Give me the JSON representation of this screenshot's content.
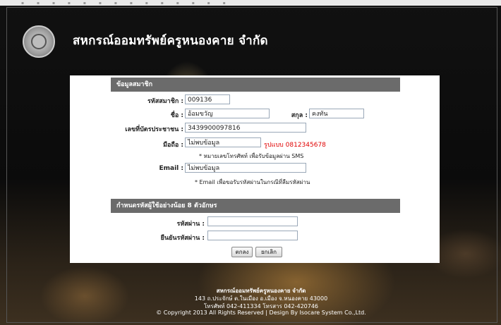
{
  "header": {
    "title": "สหกรณ์ออมทรัพย์ครูหนองคาย จำกัด"
  },
  "member_section": {
    "heading": "ข้อมูลสมาชิก",
    "member_id_label": "รหัสสมาชิก :",
    "member_id_value": "009136",
    "firstname_label": "ชื่อ :",
    "firstname_value": "อ้อมขวัญ",
    "lastname_label": "สกุล :",
    "lastname_value": "คงทัน",
    "citizen_id_label": "เลขที่บัตรประชาชน :",
    "citizen_id_value": "3439900097816",
    "mobile_label": "มือถือ :",
    "mobile_value": "ไม่พบข้อมูล",
    "mobile_format": "รูปแบบ 0812345678",
    "mobile_note": "* หมายเลขโทรศัพท์ เพื่อรับข้อมูลผ่าน SMS",
    "email_label": "Email :",
    "email_value": "ไม่พบข้อมูล",
    "email_note": "* Email เพื่อขอรับรหัสผ่านในกรณีที่ลืมรหัสผ่าน"
  },
  "password_section": {
    "heading": "กำหนดรหัสผู้ใช้อย่างน้อย 8 ตัวอักษร",
    "password_label": "รหัสผ่าน :",
    "confirm_label": "ยืนยันรหัสผ่าน :",
    "ok_button": "ตกลง",
    "cancel_button": "ยกเลิก"
  },
  "footer": {
    "org": "สหกรณ์ออมทรัพย์ครูหนองคาย จำกัด",
    "address": "143 ถ.ประจักษ์ ต.ในเมือง อ.เมือง จ.หนองคาย 43000",
    "phone": "โทรศัพท์ 042-411334 โทรสาร 042-420746",
    "copyright": "© Copyright 2013 All Rights Reserved | Design By Isocare System Co.,Ltd."
  }
}
